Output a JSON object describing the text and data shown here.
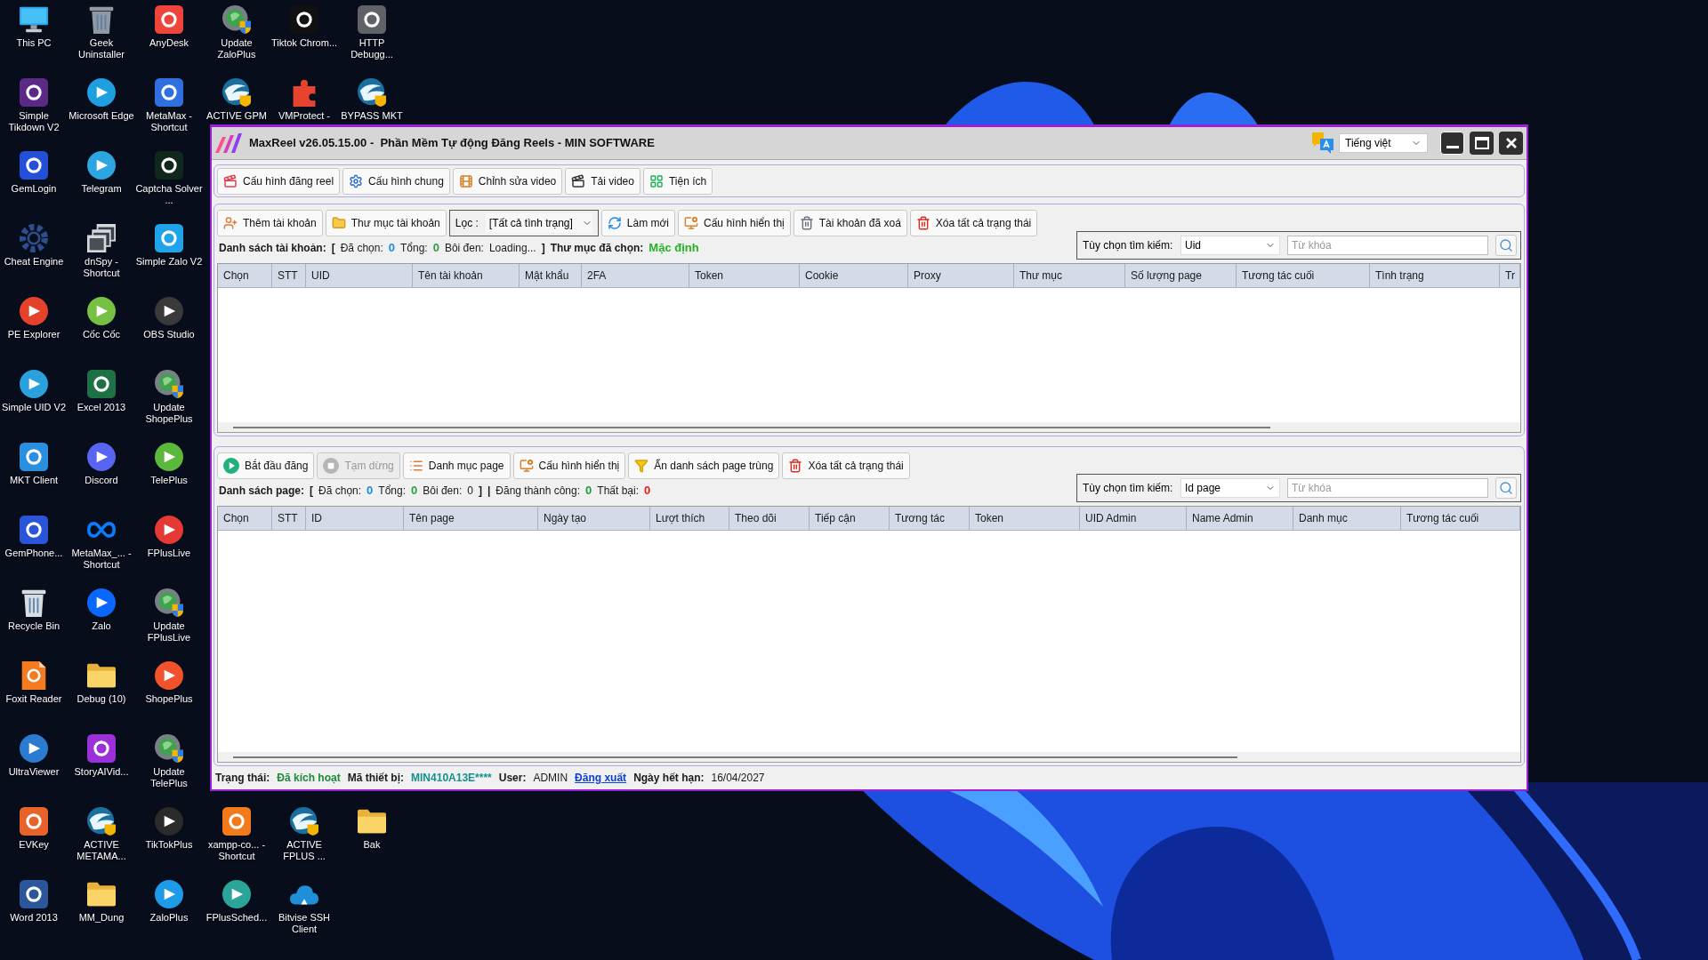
{
  "desktop": {
    "columns": [
      {
        "top": [
          {
            "label": "This PC",
            "kind": "monitor"
          },
          {
            "label": "Simple Tikdown V2",
            "kind": "tile",
            "color": "#5b2a86"
          },
          {
            "label": "GemLogin",
            "kind": "tile",
            "color": "#2450d8"
          },
          {
            "label": "Cheat Engine",
            "kind": "gear",
            "color": "#2c4f8c"
          },
          {
            "label": "PE Explorer",
            "kind": "circle",
            "color": "#e4422b"
          },
          {
            "label": "Simple UID V2",
            "kind": "circle",
            "color": "#2aa0dc"
          },
          {
            "label": "MKT Client",
            "kind": "tile",
            "color": "#2b8fe0"
          },
          {
            "label": "GemPhone...",
            "kind": "tile",
            "color": "#2a55d8"
          },
          {
            "label": "Recycle Bin",
            "kind": "bin",
            "color": "#d7dde2"
          },
          {
            "label": "Foxit Reader",
            "kind": "document",
            "color": "#f47b20"
          },
          {
            "label": "UltraViewer",
            "kind": "circle",
            "color": "#2b7bd1"
          },
          {
            "label": "EVKey",
            "kind": "tile",
            "color": "#e8632a"
          },
          {
            "label": "Word 2013",
            "kind": "tile",
            "color": "#2b579a"
          }
        ]
      },
      {
        "top": [
          {
            "label": "Geek Uninstaller",
            "kind": "bin",
            "color": "#8f9aa3"
          },
          {
            "label": "Microsoft Edge",
            "kind": "circle",
            "color": "#1d9fe0"
          },
          {
            "label": "Telegram",
            "kind": "circle",
            "color": "#2ca5e0"
          },
          {
            "label": "dnSpy - Shortcut",
            "kind": "stack",
            "color": "#d4d8dc"
          },
          {
            "label": "Cốc Cốc",
            "kind": "circle",
            "color": "#76c043"
          },
          {
            "label": "Excel 2013",
            "kind": "tile",
            "color": "#1e7145"
          },
          {
            "label": "Discord",
            "kind": "circle",
            "color": "#5865f2"
          },
          {
            "label": "MetaMax_... - Shortcut",
            "kind": "infinity",
            "color": "#0a7cff"
          },
          {
            "label": "Zalo",
            "kind": "circle",
            "color": "#0a68ff"
          },
          {
            "label": "Debug (10)",
            "kind": "folder"
          },
          {
            "label": "StoryAIVid...",
            "kind": "tile",
            "color": "#9b30d8"
          },
          {
            "label": "ACTIVE METAMA...",
            "kind": "swirl"
          },
          {
            "label": "MM_Dung",
            "kind": "folder"
          }
        ]
      },
      {
        "top": [
          {
            "label": "AnyDesk",
            "kind": "tile",
            "color": "#ef443b"
          },
          {
            "label": "MetaMax - Shortcut",
            "kind": "tile",
            "color": "#2f6fe0"
          },
          {
            "label": "Captcha Solver ...",
            "kind": "tile",
            "color": "#10271c"
          },
          {
            "label": "Simple Zalo V2",
            "kind": "tile",
            "color": "#1fa3ea"
          },
          {
            "label": "OBS Studio",
            "kind": "circle",
            "color": "#3a3a3a"
          },
          {
            "label": "Update ShopePlus",
            "kind": "update"
          },
          {
            "label": "TelePlus",
            "kind": "circle",
            "color": "#5cb83c"
          },
          {
            "label": "FPlusLive",
            "kind": "circle",
            "color": "#e53935"
          },
          {
            "label": "Update FPlusLive",
            "kind": "update"
          },
          {
            "label": "ShopePlus",
            "kind": "circle",
            "color": "#f0522c"
          },
          {
            "label": "Update TelePlus",
            "kind": "update"
          },
          {
            "label": "TikTokPlus",
            "kind": "circle",
            "color": "#2b2b2b"
          },
          {
            "label": "ZaloPlus",
            "kind": "circle",
            "color": "#1e9be8"
          }
        ]
      },
      {
        "top": [
          {
            "label": "Update ZaloPlus",
            "kind": "update"
          },
          {
            "label": "ACTIVE GPM",
            "kind": "swirl"
          }
        ],
        "bottom": [
          {
            "label": "xampp-co... - Shortcut",
            "kind": "tile",
            "color": "#f27a1a"
          },
          {
            "label": "FPlusSched...",
            "kind": "circle",
            "color": "#2ba59a"
          }
        ]
      },
      {
        "top": [
          {
            "label": "Tiktok Chrom...",
            "kind": "tile",
            "color": "#111111"
          },
          {
            "label": "VMProtect -",
            "kind": "puzzle",
            "color": "#e8432e"
          }
        ],
        "bottom": [
          {
            "label": "ACTIVE FPLUS ...",
            "kind": "swirl"
          },
          {
            "label": "Bitvise SSH Client",
            "kind": "cloud",
            "color": "#1f8fd8"
          }
        ]
      },
      {
        "top": [
          {
            "label": "HTTP Debugg...",
            "kind": "tile",
            "color": "#5f6368"
          },
          {
            "label": "BYPASS MKT",
            "kind": "swirl"
          }
        ],
        "bottom": [
          {
            "label": "Bak",
            "kind": "folder"
          }
        ]
      }
    ]
  },
  "window": {
    "title": "MaxReel v26.05.15.00 -  Phần Mềm Tự động Đăng Reels - MIN SOFTWARE",
    "language": "Tiếng việt"
  },
  "main_toolbar": [
    {
      "label": "Cấu hình đăng reel",
      "kind": "clapper"
    },
    {
      "label": "Cấu hình chung",
      "kind": "gear"
    },
    {
      "label": "Chỉnh sửa video",
      "kind": "film"
    },
    {
      "label": "Tải video",
      "kind": "download"
    },
    {
      "label": "Tiện ích",
      "kind": "grid"
    }
  ],
  "accounts": {
    "toolbar": [
      {
        "label": "Thêm tài khoản",
        "kind": "user-add"
      },
      {
        "label": "Thư mục tài khoản",
        "kind": "folder"
      },
      {
        "kind": "combo",
        "label": "Lọc :",
        "value": "[Tất cả tình trạng]"
      },
      {
        "label": "Làm mới",
        "kind": "refresh"
      },
      {
        "label": "Cấu hình hiển thị",
        "kind": "display"
      },
      {
        "label": "Tài khoản đã xoá",
        "kind": "deleted"
      },
      {
        "label": "Xóa tất cả trạng thái",
        "kind": "clear"
      }
    ],
    "search": {
      "label": "Tùy chọn tìm kiếm:",
      "option": "Uid",
      "placeholder": "Từ khóa"
    },
    "summary": [
      {
        "kind": "heading",
        "text": "Danh sách tài khoản:"
      },
      {
        "kind": "mark",
        "text": "["
      },
      {
        "kind": "label",
        "text": "Đã chọn:"
      },
      {
        "kind": "value",
        "text": "0",
        "color": "#1e88e5"
      },
      {
        "kind": "label",
        "text": "Tổng:"
      },
      {
        "kind": "value",
        "text": "0",
        "color": "#2e9e44"
      },
      {
        "kind": "label",
        "text": "Bôi đen:"
      },
      {
        "kind": "plain",
        "text": "Loading..."
      },
      {
        "kind": "mark",
        "text": "]"
      },
      {
        "kind": "heading",
        "text": "Thư mục đã chọn:"
      },
      {
        "kind": "value",
        "text": "Mặc định",
        "color": "#22b322"
      }
    ],
    "columns": [
      "Chọn",
      "STT",
      "UID",
      "Tên tài khoản",
      "Mật khẩu",
      "2FA",
      "Token",
      "Cookie",
      "Proxy",
      "Thư mục",
      "Số lượng page",
      "Tương tác cuối",
      "Tình trạng",
      "Tr"
    ]
  },
  "pages": {
    "toolbar": [
      {
        "label": "Bắt đầu đăng",
        "kind": "play",
        "disabled": false
      },
      {
        "label": "Tạm dừng",
        "kind": "stop",
        "disabled": true
      },
      {
        "label": "Danh mục page",
        "kind": "list",
        "disabled": false
      },
      {
        "label": "Cấu hình hiển thị",
        "kind": "display",
        "disabled": false
      },
      {
        "label": "Ẩn danh sách page trùng",
        "kind": "filter",
        "disabled": false
      },
      {
        "label": "Xóa tất cả trạng thái",
        "kind": "clear",
        "disabled": false
      }
    ],
    "search": {
      "label": "Tùy chọn tìm kiếm:",
      "option": "Id page",
      "placeholder": "Từ khóa"
    },
    "summary": [
      {
        "kind": "heading",
        "text": "Danh sách page:"
      },
      {
        "kind": "mark",
        "text": "["
      },
      {
        "kind": "label",
        "text": "Đã chọn:"
      },
      {
        "kind": "value",
        "text": "0",
        "color": "#1e88e5"
      },
      {
        "kind": "label",
        "text": "Tổng:"
      },
      {
        "kind": "value",
        "text": "0",
        "color": "#2e9e44"
      },
      {
        "kind": "label",
        "text": "Bôi đen:"
      },
      {
        "kind": "plain",
        "text": "0"
      },
      {
        "kind": "mark",
        "text": "]"
      },
      {
        "kind": "mark",
        "text": "|"
      },
      {
        "kind": "label",
        "text": "Đăng thành công:"
      },
      {
        "kind": "value",
        "text": "0",
        "color": "#1a9e3a"
      },
      {
        "kind": "label",
        "text": "Thất bại:"
      },
      {
        "kind": "value",
        "text": "0",
        "color": "#e02020"
      }
    ],
    "columns": [
      "Chọn",
      "STT",
      "ID",
      "Tên page",
      "Ngày tạo",
      "Lượt thích",
      "Theo dõi",
      "Tiếp cận",
      "Tương tác",
      "Token",
      "UID Admin",
      "Name Admin",
      "Danh mục",
      "Tương tác cuối"
    ]
  },
  "status_bar": [
    {
      "kind": "label",
      "text": "Trạng thái:"
    },
    {
      "kind": "value",
      "text": "Đã kích hoạt",
      "color": "#1b8a3a"
    },
    {
      "kind": "label",
      "text": "Mã thiết bị:"
    },
    {
      "kind": "value",
      "text": "MIN410A13E****",
      "color": "#14918c"
    },
    {
      "kind": "label",
      "text": "User:"
    },
    {
      "kind": "plain",
      "text": "ADMIN"
    },
    {
      "kind": "link",
      "text": "Đăng xuất"
    },
    {
      "kind": "label",
      "text": "Ngày hết hạn:"
    },
    {
      "kind": "plain",
      "text": "16/04/2027"
    }
  ]
}
